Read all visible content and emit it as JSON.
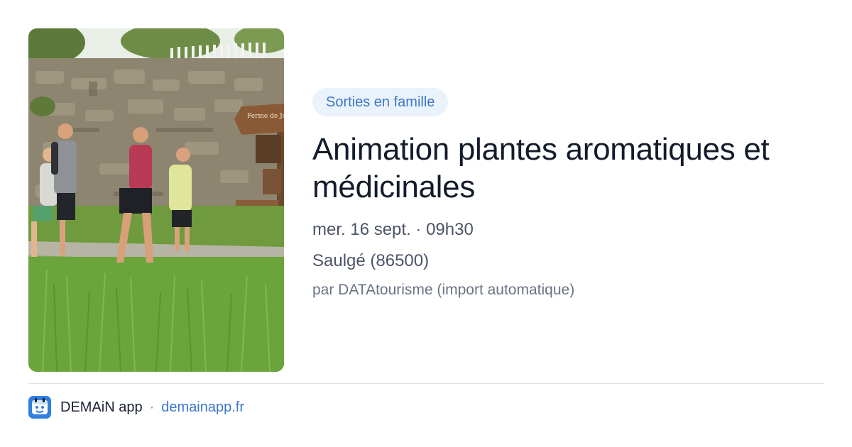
{
  "card": {
    "category": "Sorties en famille",
    "title": "Animation plantes aromatiques et médicinales",
    "datetime": "mer. 16 sept. · 09h30",
    "location": "Saulgé (86500)",
    "source": "par DATAtourisme (import automatique)"
  },
  "photo": {
    "sign_text": "Ferme de Jo"
  },
  "footer": {
    "app_name": "DEMAiN app",
    "separator": "·",
    "domain": "demainapp.fr"
  },
  "colors": {
    "accent": "#3b78c9",
    "tag_bg": "#eaf2fc",
    "app_icon": "#2f7fe0"
  }
}
